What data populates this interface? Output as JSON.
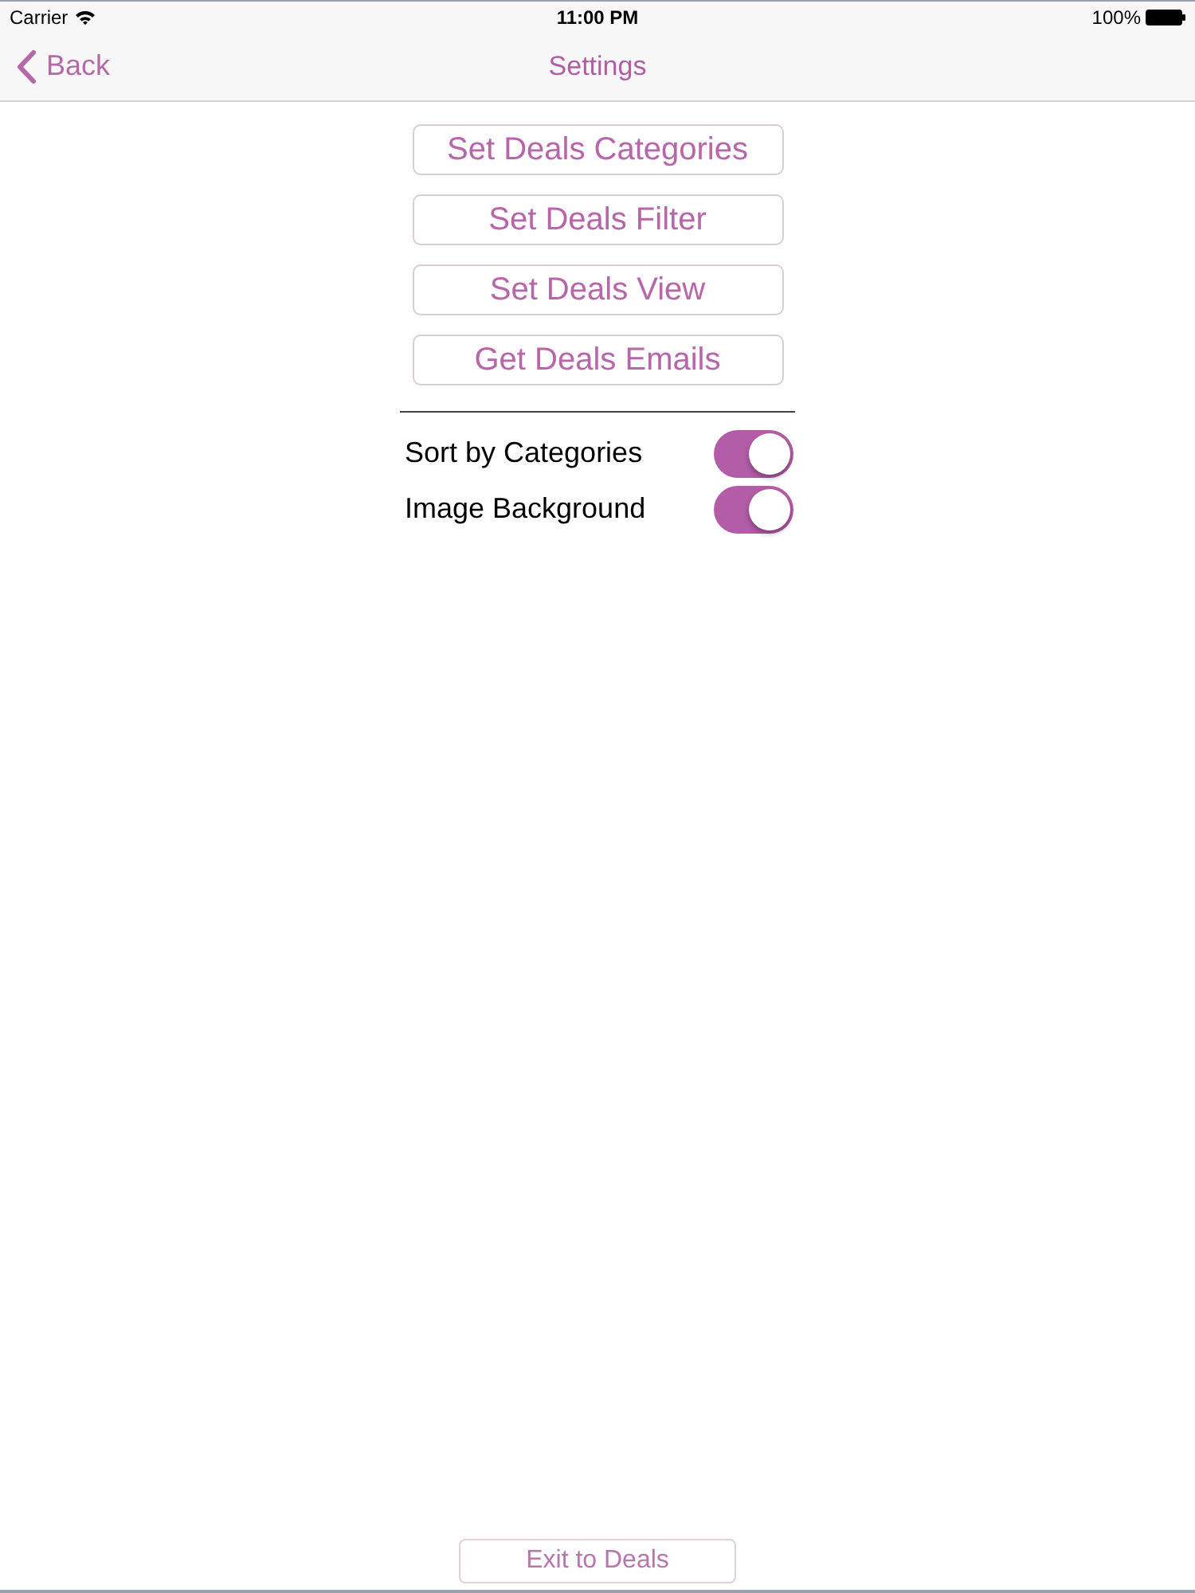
{
  "status_bar": {
    "carrier": "Carrier",
    "time": "11:00 PM",
    "battery": "100%"
  },
  "nav_bar": {
    "back": "Back",
    "title": "Settings"
  },
  "buttons": [
    "Set Deals Categories",
    "Set Deals Filter",
    "Set Deals View",
    "Get Deals Emails"
  ],
  "toggles": [
    {
      "label": "Sort by Categories",
      "on": true
    },
    {
      "label": "Image Background",
      "on": true
    }
  ],
  "footer": {
    "button": "Exit to Deals"
  }
}
